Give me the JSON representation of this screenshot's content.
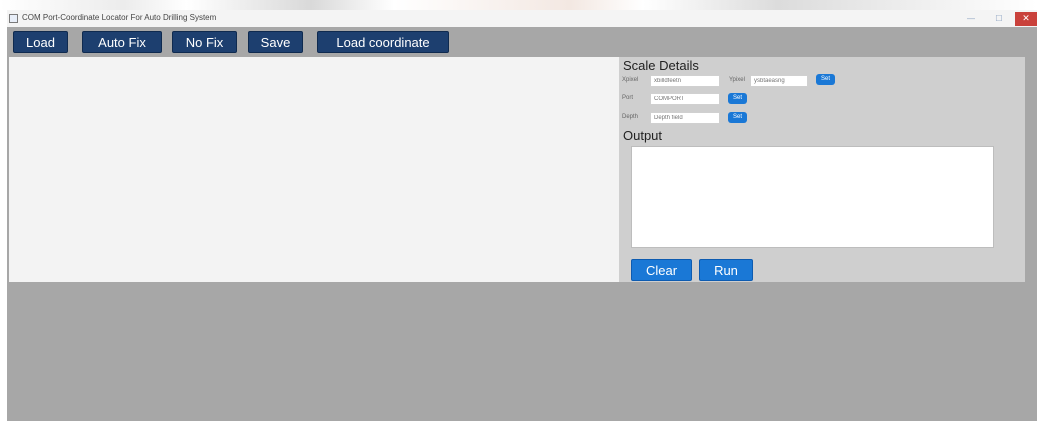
{
  "window": {
    "title": "COM Port-Coordinate Locator For Auto Drilling System",
    "controls": {
      "minimize": "—",
      "maximize": "☐",
      "close": "✕"
    }
  },
  "toolbar": {
    "buttons": [
      "Load",
      "Auto Fix",
      "No Fix",
      "Save",
      "Load coordinate"
    ]
  },
  "scale_details": {
    "title": "Scale Details",
    "fields": {
      "xpixel": {
        "label": "Xpixel",
        "placeholder": "xbilldfeetn"
      },
      "ypixel": {
        "label": "Ypixel",
        "placeholder": "ysbtaeasng"
      },
      "port": {
        "label": "Port",
        "placeholder": "COMPORT"
      },
      "depth": {
        "label": "Depth",
        "placeholder": "Depth field"
      }
    },
    "set_label": "Set"
  },
  "output": {
    "title": "Output",
    "value": ""
  },
  "actions": {
    "clear": "Clear",
    "run": "Run"
  },
  "colors": {
    "toolbar_button": "#1d3f6f",
    "action_button": "#1a78d6",
    "window_background": "#a7a7a7",
    "canvas_background": "#f3f3f3",
    "panel_background": "#cfcfcf",
    "close_button": "#c9413b"
  }
}
